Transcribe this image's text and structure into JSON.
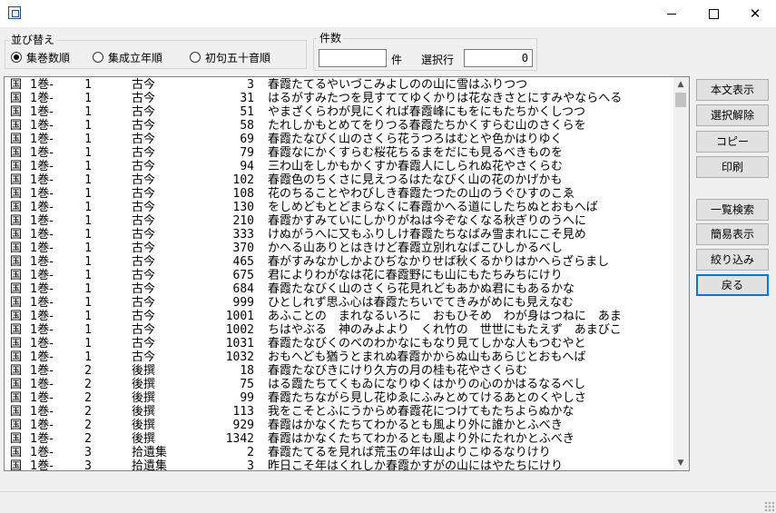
{
  "window": {
    "title": "",
    "minimize_glyph": "",
    "maximize_glyph": "",
    "close_glyph": "✕"
  },
  "sort": {
    "label": "並び替え",
    "options": [
      {
        "label": "集巻数順",
        "selected": true
      },
      {
        "label": "集成立年順",
        "selected": false
      },
      {
        "label": "初句五十音順",
        "selected": false
      }
    ]
  },
  "counts": {
    "label": "件数",
    "count_value": "",
    "count_unit": "件",
    "selected_label": "選択行",
    "selected_value": "0"
  },
  "buttons": {
    "show_text": "本文表示",
    "deselect": "選択解除",
    "copy": "コピー",
    "print": "印刷",
    "list_search": "一覧検索",
    "simple_view": "簡易表示",
    "narrow": "絞り込み",
    "back": "戻る"
  },
  "rows": [
    {
      "kuni": "国",
      "vol": "1巻-",
      "num": "1",
      "coll": "古今",
      "no": "3",
      "poem": "春霞たてるやいづこみよしのの山に雪はふりつつ"
    },
    {
      "kuni": "国",
      "vol": "1巻-",
      "num": "1",
      "coll": "古今",
      "no": "31",
      "poem": "はるがすみたつを見すててゆくかりは花なきさとにすみやならへる"
    },
    {
      "kuni": "国",
      "vol": "1巻-",
      "num": "1",
      "coll": "古今",
      "no": "51",
      "poem": "やまざくらわが見にくれば春霞峰にもをにもたちかくしつつ"
    },
    {
      "kuni": "国",
      "vol": "1巻-",
      "num": "1",
      "coll": "古今",
      "no": "58",
      "poem": "たれしかもとめてをりつる春霞たちかくすらむ山のさくらを"
    },
    {
      "kuni": "国",
      "vol": "1巻-",
      "num": "1",
      "coll": "古今",
      "no": "69",
      "poem": "春霞たなびく山のさくら花うつろはむとや色かはりゆく"
    },
    {
      "kuni": "国",
      "vol": "1巻-",
      "num": "1",
      "coll": "古今",
      "no": "79",
      "poem": "春霞なにかくすらむ桜花ちるまをだにも見るべきものを"
    },
    {
      "kuni": "国",
      "vol": "1巻-",
      "num": "1",
      "coll": "古今",
      "no": "94",
      "poem": "三わ山をしかもかくすか春霞人にしられぬ花やさくらむ"
    },
    {
      "kuni": "国",
      "vol": "1巻-",
      "num": "1",
      "coll": "古今",
      "no": "102",
      "poem": "春霞色のちくさに見えつるはたなびく山の花のかげかも"
    },
    {
      "kuni": "国",
      "vol": "1巻-",
      "num": "1",
      "coll": "古今",
      "no": "108",
      "poem": "花のちることやわびしき春霞たつたの山のうぐひすのこゑ"
    },
    {
      "kuni": "国",
      "vol": "1巻-",
      "num": "1",
      "coll": "古今",
      "no": "130",
      "poem": "をしめどもとどまらなくに春霞かへる道にしたちぬとおもへば"
    },
    {
      "kuni": "国",
      "vol": "1巻-",
      "num": "1",
      "coll": "古今",
      "no": "210",
      "poem": "春霞かすみていにしかりがねは今ぞなくなる秋ぎりのうへに"
    },
    {
      "kuni": "国",
      "vol": "1巻-",
      "num": "1",
      "coll": "古今",
      "no": "333",
      "poem": "けぬがうへに又もふりしけ春霞たちなばみ雪まれにこそ見め"
    },
    {
      "kuni": "国",
      "vol": "1巻-",
      "num": "1",
      "coll": "古今",
      "no": "370",
      "poem": "かへる山ありとはきけど春霞立別れなばこひしかるべし"
    },
    {
      "kuni": "国",
      "vol": "1巻-",
      "num": "1",
      "coll": "古今",
      "no": "465",
      "poem": "春がすみなかしかよひぢなかりせば秋くるかりはかへらざらまし"
    },
    {
      "kuni": "国",
      "vol": "1巻-",
      "num": "1",
      "coll": "古今",
      "no": "675",
      "poem": "君によりわがなは花に春霞野にも山にもたちみちにけり"
    },
    {
      "kuni": "国",
      "vol": "1巻-",
      "num": "1",
      "coll": "古今",
      "no": "684",
      "poem": "春霞たなびく山のさくら花見れどもあかぬ君にもあるかな"
    },
    {
      "kuni": "国",
      "vol": "1巻-",
      "num": "1",
      "coll": "古今",
      "no": "999",
      "poem": "ひとしれず思ふ心は春霞たちいでてきみがめにも見えなむ"
    },
    {
      "kuni": "国",
      "vol": "1巻-",
      "num": "1",
      "coll": "古今",
      "no": "1001",
      "poem": "あふことの　まれなるいろに　おもひそめ　わが身はつねに　あま"
    },
    {
      "kuni": "国",
      "vol": "1巻-",
      "num": "1",
      "coll": "古今",
      "no": "1002",
      "poem": "ちはやぶる　神のみよより　くれ竹の　世世にもたえず　あまびこ"
    },
    {
      "kuni": "国",
      "vol": "1巻-",
      "num": "1",
      "coll": "古今",
      "no": "1031",
      "poem": "春霞たなびくのべのわかなにもなり見てしかな人もつむやと"
    },
    {
      "kuni": "国",
      "vol": "1巻-",
      "num": "1",
      "coll": "古今",
      "no": "1032",
      "poem": "おもへども猶うとまれぬ春霞かからぬ山もあらじとおもへば"
    },
    {
      "kuni": "国",
      "vol": "1巻-",
      "num": "2",
      "coll": "後撰",
      "no": "18",
      "poem": "春霞たなびきにけり久方の月の桂も花やさくらむ"
    },
    {
      "kuni": "国",
      "vol": "1巻-",
      "num": "2",
      "coll": "後撰",
      "no": "75",
      "poem": "はる霞たちてくもゐになりゆくはかりの心のかはるなるべし"
    },
    {
      "kuni": "国",
      "vol": "1巻-",
      "num": "2",
      "coll": "後撰",
      "no": "99",
      "poem": "春霞たちながら見し花ゆゑにふみとめてけるあとのくやしさ"
    },
    {
      "kuni": "国",
      "vol": "1巻-",
      "num": "2",
      "coll": "後撰",
      "no": "113",
      "poem": "我をこそとふにうからめ春霞花につけてもたちよらぬかな"
    },
    {
      "kuni": "国",
      "vol": "1巻-",
      "num": "2",
      "coll": "後撰",
      "no": "929",
      "poem": "春霞はかなくたちてわかるとも風より外に誰かとふべき"
    },
    {
      "kuni": "国",
      "vol": "1巻-",
      "num": "2",
      "coll": "後撰",
      "no": "1342",
      "poem": "春霞はかなくたちてわかるとも風より外にたれかとふべき"
    },
    {
      "kuni": "国",
      "vol": "1巻-",
      "num": "3",
      "coll": "拾遺集",
      "no": "2",
      "poem": "春霞たてるを見れば荒玉の年は山よりこゆるなりけり"
    },
    {
      "kuni": "国",
      "vol": "1巻-",
      "num": "3",
      "coll": "拾遺集",
      "no": "3",
      "poem": "昨日こそ年はくれしか春霞かすがの山にはやたちにけり"
    }
  ]
}
